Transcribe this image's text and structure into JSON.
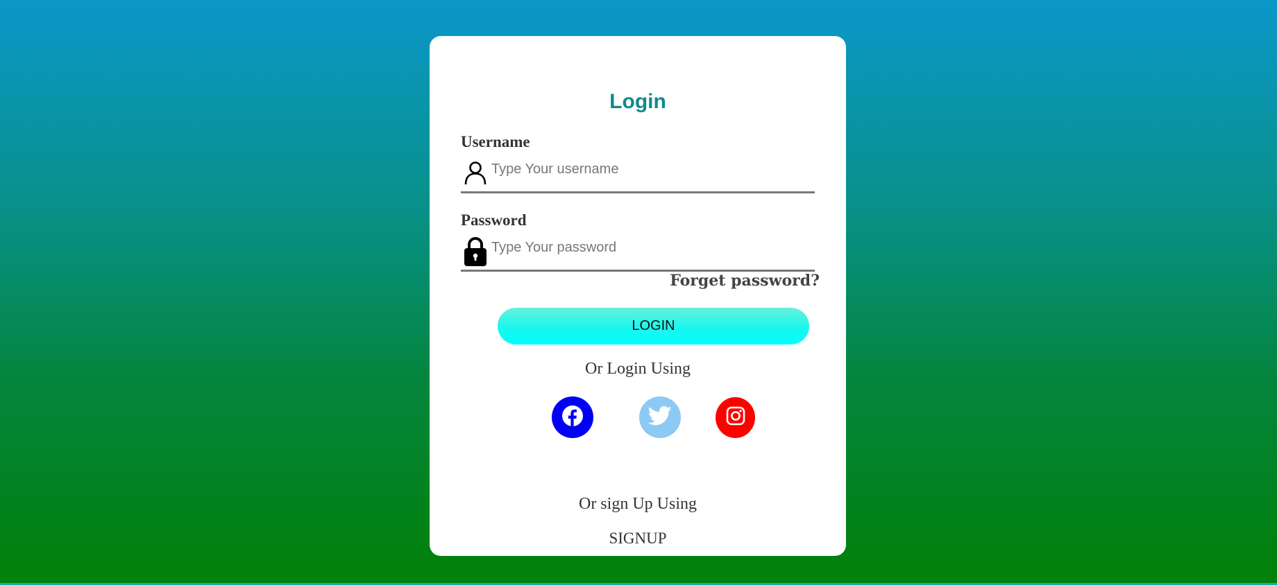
{
  "form": {
    "title": "Login",
    "username": {
      "label": "Username",
      "placeholder": "Type Your username",
      "value": "",
      "icon": "user-icon"
    },
    "password": {
      "label": "Password",
      "placeholder": "Type Your password",
      "value": "",
      "icon": "lock-icon"
    },
    "forget_password_label": "Forget password?",
    "login_button_label": "LOGIN",
    "or_login_text": "Or Login Using",
    "social": [
      {
        "name": "facebook",
        "icon": "facebook-icon",
        "color": "#0000f5"
      },
      {
        "name": "twitter",
        "icon": "twitter-icon",
        "color": "#8dc9f5"
      },
      {
        "name": "instagram",
        "icon": "instagram-icon",
        "color": "#ff0000"
      }
    ],
    "or_signup_text": "Or sign Up Using",
    "signup_label": "SIGNUP"
  },
  "colors": {
    "background_top": "#0b97c9",
    "background_bottom": "#018008",
    "title": "#0f8a8a",
    "login_button": "#00ffff"
  }
}
